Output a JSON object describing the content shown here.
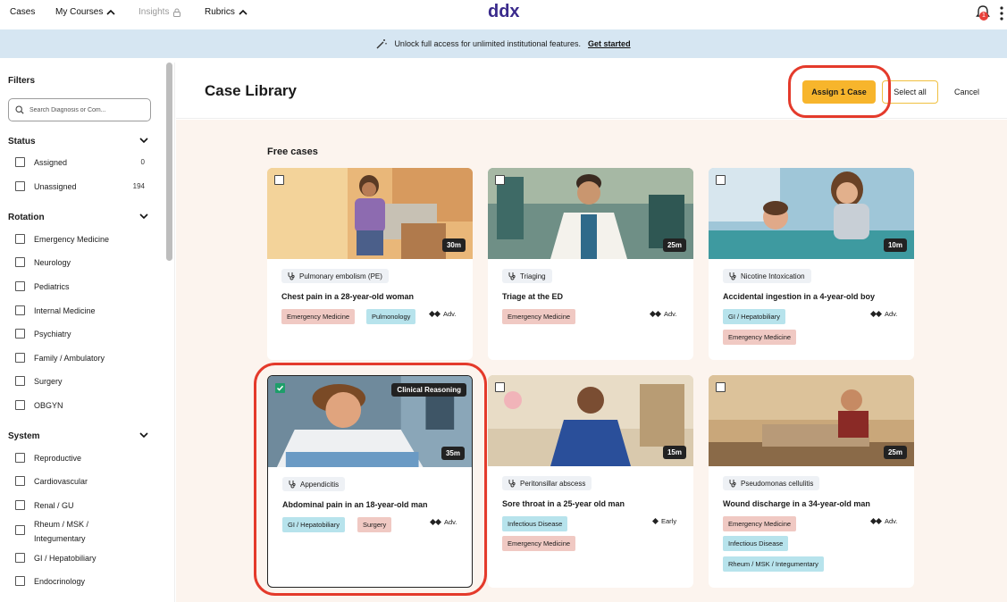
{
  "nav": {
    "cases": "Cases",
    "my_courses": "My Courses",
    "insights": "Insights",
    "rubrics": "Rubrics",
    "logo": "ddx",
    "notification_count": "1"
  },
  "banner": {
    "text": "Unlock full access for unlimited institutional features.",
    "link": "Get started"
  },
  "sidebar": {
    "title": "Filters",
    "search_placeholder": "Search Diagnosis or Com...",
    "status": {
      "label": "Status",
      "options": [
        {
          "label": "Assigned",
          "count": "0"
        },
        {
          "label": "Unassigned",
          "count": "194"
        }
      ]
    },
    "rotation": {
      "label": "Rotation",
      "options": [
        "Emergency Medicine",
        "Neurology",
        "Pediatrics",
        "Internal Medicine",
        "Psychiatry",
        "Family / Ambulatory",
        "Surgery",
        "OBGYN"
      ]
    },
    "system": {
      "label": "System",
      "options": [
        "Reproductive",
        "Cardiovascular",
        "Renal / GU",
        "Rheum / MSK / Integumentary",
        "GI / Hepatobiliary",
        "Endocrinology"
      ]
    }
  },
  "header": {
    "title": "Case Library",
    "assign_label": "Assign 1 Case",
    "select_all_label": "Select all",
    "cancel_label": "Cancel"
  },
  "section_title": "Free cases",
  "cards": [
    {
      "diagnosis": "Pulmonary embolism (PE)",
      "title": "Chest pain in a 28-year-old woman",
      "duration": "30m",
      "tags": [
        "Emergency Medicine",
        "Pulmonology"
      ],
      "level": "Adv.",
      "checked": false
    },
    {
      "diagnosis": "Triaging",
      "title": "Triage at the ED",
      "duration": "25m",
      "tags": [
        "Emergency Medicine"
      ],
      "level": "Adv.",
      "checked": false
    },
    {
      "diagnosis": "Nicotine Intoxication",
      "title": "Accidental ingestion in a 4-year-old boy",
      "duration": "10m",
      "tags": [
        "GI / Hepatobiliary",
        "Emergency Medicine"
      ],
      "level": "Adv.",
      "checked": false
    },
    {
      "diagnosis": "Appendicitis",
      "title": "Abdominal pain in an 18-year-old man",
      "duration": "35m",
      "ribbon": "Clinical Reasoning",
      "tags": [
        "GI / Hepatobiliary",
        "Surgery"
      ],
      "level": "Adv.",
      "checked": true
    },
    {
      "diagnosis": "Peritonsillar abscess",
      "title": "Sore throat in a 25-year old man",
      "duration": "15m",
      "tags": [
        "Infectious Disease",
        "Emergency Medicine"
      ],
      "level": "Early",
      "checked": false
    },
    {
      "diagnosis": "Pseudomonas cellulitis",
      "title": "Wound discharge in a 34-year-old man",
      "duration": "25m",
      "tags": [
        "Emergency Medicine",
        "Infectious Disease",
        "Rheum / MSK / Integumentary"
      ],
      "level": "Adv.",
      "checked": false
    }
  ],
  "colors": {
    "accent": "#f7b52c",
    "banner_bg": "#d6e6f2",
    "tag_emergency": "#f0c9c3",
    "tag_blue": "#b7e3ec",
    "highlight_ring": "#e43a2b",
    "checked": "#1e9e6a",
    "content_bg": "#fcf4ee"
  }
}
